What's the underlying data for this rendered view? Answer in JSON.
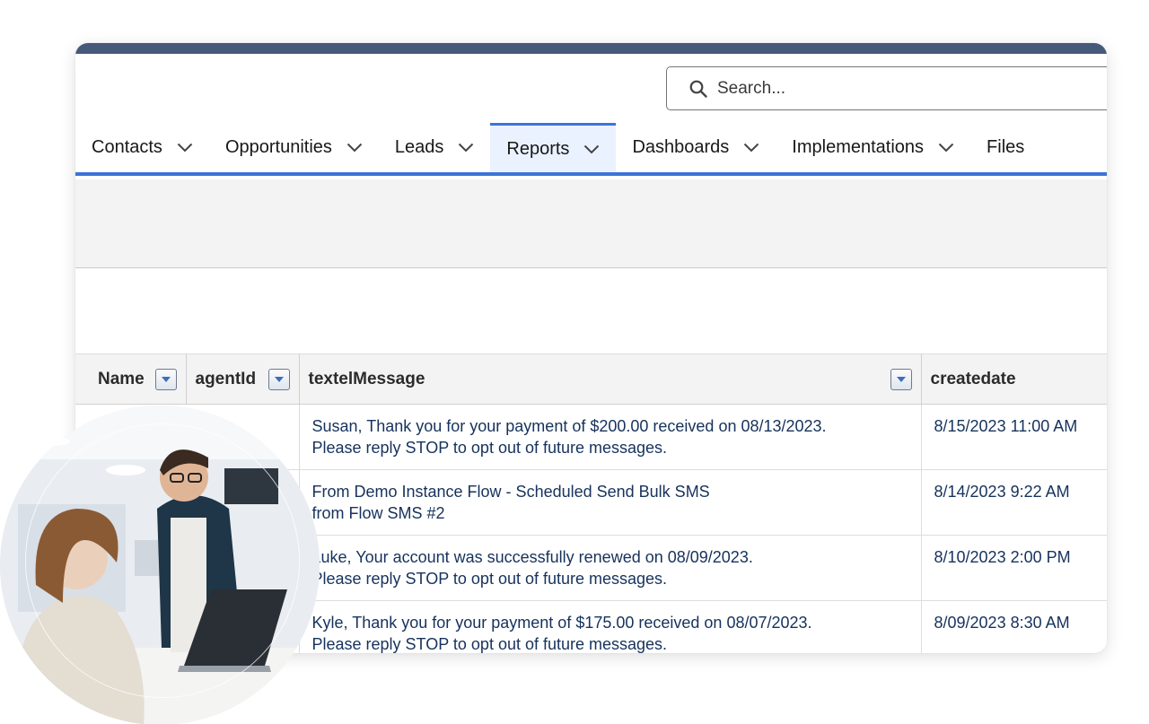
{
  "search": {
    "placeholder": "Search..."
  },
  "nav": {
    "items": [
      {
        "label": "Contacts"
      },
      {
        "label": "Opportunities"
      },
      {
        "label": "Leads"
      },
      {
        "label": "Reports"
      },
      {
        "label": "Dashboards"
      },
      {
        "label": "Implementations"
      },
      {
        "label": "Files"
      }
    ],
    "active": "Reports"
  },
  "table": {
    "columns": [
      "Name",
      "agentId",
      "textelMessage",
      "createdate"
    ],
    "rows": [
      {
        "name": "",
        "agentId": "",
        "message": [
          "Susan, Thank you for your payment of $200.00 received on 08/13/2023.",
          "Please reply STOP to opt out of future messages."
        ],
        "createdate": "8/15/2023 11:00 AM"
      },
      {
        "name": "",
        "agentId": "",
        "message": [
          "From Demo Instance Flow - Scheduled Send Bulk SMS",
          "from Flow SMS #2"
        ],
        "createdate": "8/14/2023 9:22 AM"
      },
      {
        "name": "",
        "agentId": "",
        "message": [
          "Luke, Your account was successfully renewed on 08/09/2023.",
          "Please reply STOP to opt out of future messages."
        ],
        "createdate": "8/10/2023 2:00 PM"
      },
      {
        "name": "",
        "agentId": "",
        "message": [
          "Kyle, Thank you for your payment of $175.00 received on 08/07/2023.",
          "Please reply STOP to opt out of future messages."
        ],
        "createdate": "8/09/2023 8:30 AM"
      }
    ]
  },
  "colors": {
    "accent": "#3b74d9",
    "header_strip": "#46597a",
    "text_dark_blue": "#16325c",
    "band_gray": "#f3f3f3"
  }
}
